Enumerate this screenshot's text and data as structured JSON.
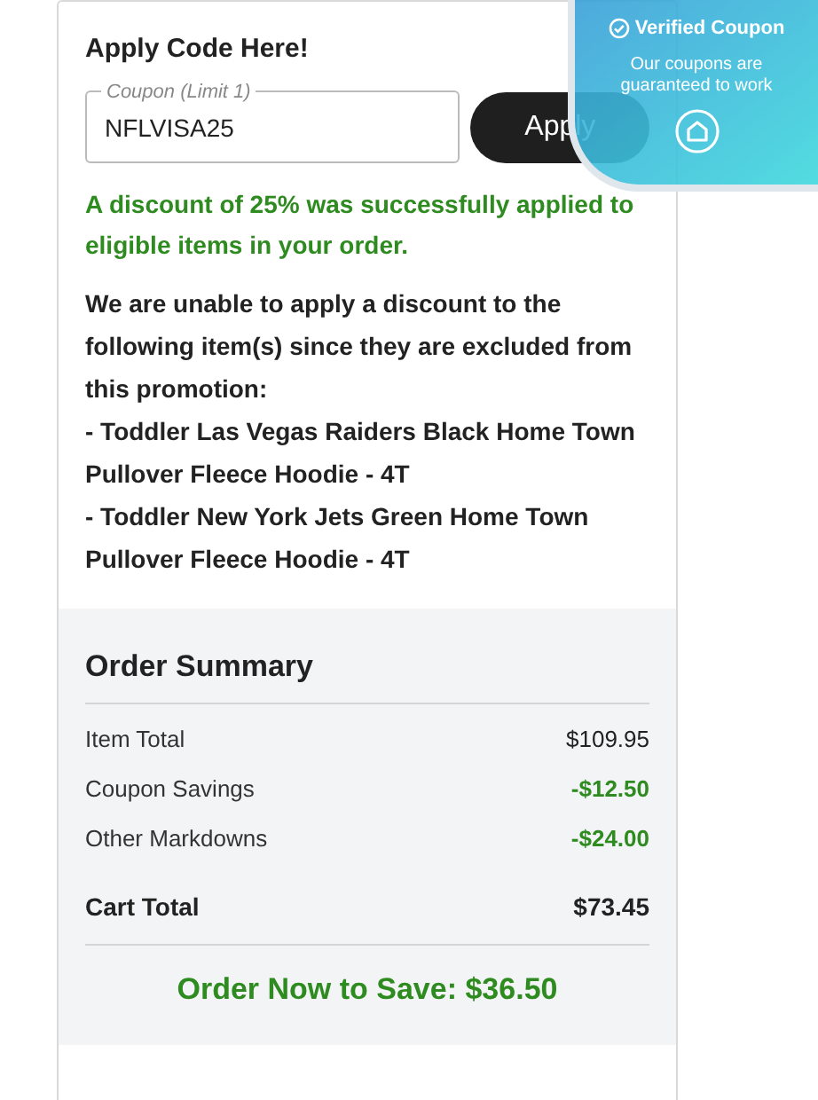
{
  "coupon_form": {
    "title": "Apply Code Here!",
    "field": {
      "label": "Coupon (Limit 1)",
      "value": "NFLVISA25"
    },
    "apply_button": "Apply"
  },
  "success_message": "A discount of 25% was successfully applied to eligible items in your order.",
  "exclusion_notice": {
    "intro": "We are unable to apply a discount to the following item(s) since they are excluded from this promotion:",
    "items": [
      "- Toddler Las Vegas Raiders Black Home Town Pullover Fleece Hoodie - 4T",
      "- Toddler New York Jets Green Home Town Pullover Fleece Hoodie - 4T"
    ]
  },
  "order_summary": {
    "title": "Order Summary",
    "rows": [
      {
        "kind": "regular",
        "label": "Item Total",
        "value": "$109.95"
      },
      {
        "kind": "savings",
        "label": "Coupon Savings",
        "value": "-$12.50"
      },
      {
        "kind": "savings",
        "label": "Other Markdowns",
        "value": "-$24.00"
      }
    ],
    "total": {
      "label": "Cart Total",
      "value": "$73.45"
    },
    "savings_banner": "Order Now to Save: $36.50"
  },
  "verified_badge": {
    "title": "Verified Coupon",
    "text": "Our coupons are guaranteed to work"
  }
}
